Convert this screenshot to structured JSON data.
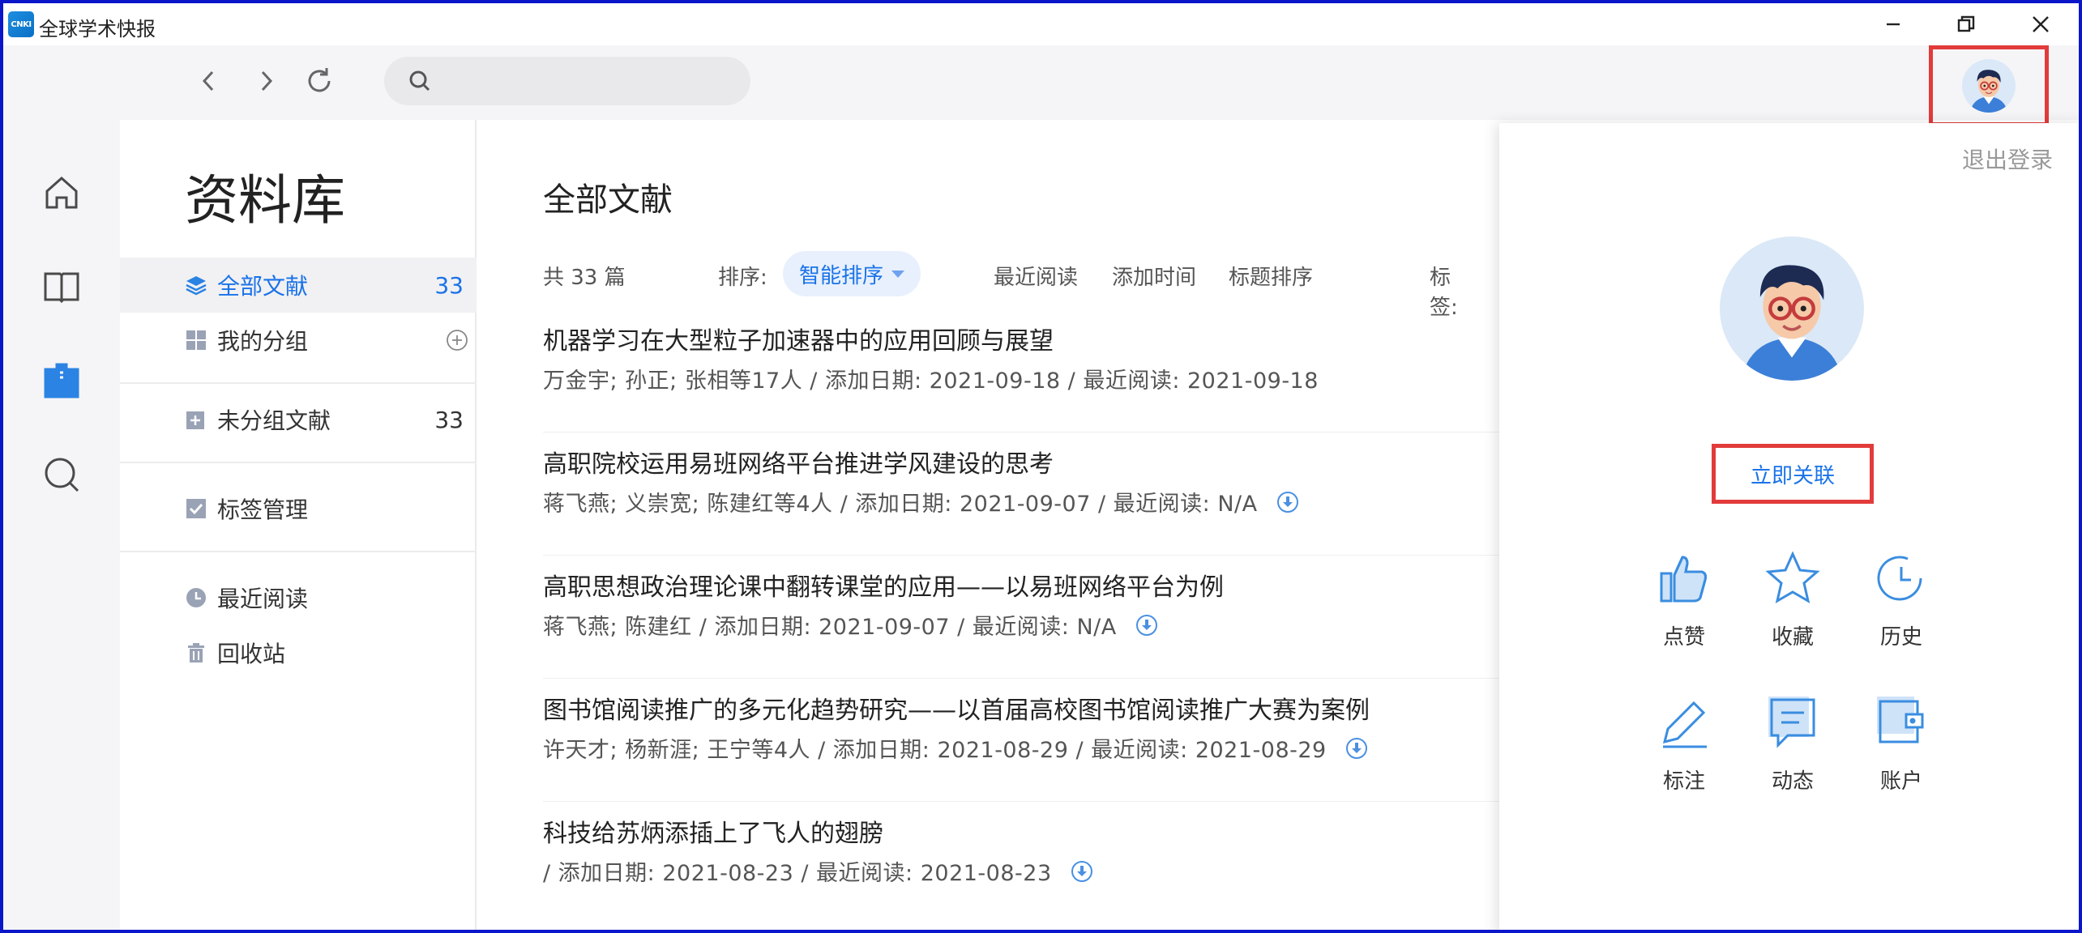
{
  "app": {
    "title": "全球学术快报",
    "logo_text": "CNKI"
  },
  "toolbar": {
    "search_placeholder": ""
  },
  "library": {
    "title": "资料库",
    "items": [
      {
        "label": "全部文献",
        "count": "33"
      },
      {
        "label": "我的分组",
        "count": ""
      },
      {
        "label": "未分组文献",
        "count": "33"
      },
      {
        "label": "标签管理",
        "count": ""
      },
      {
        "label": "最近阅读",
        "count": ""
      },
      {
        "label": "回收站",
        "count": ""
      }
    ]
  },
  "main": {
    "title": "全部文献",
    "total": "共 33 篇",
    "sort_label": "排序:",
    "sort_options": [
      "智能排序",
      "最近阅读",
      "添加时间",
      "标题排序"
    ],
    "tag_label": "标签:",
    "documents": [
      {
        "title": "机器学习在大型粒子加速器中的应用回顾与展望",
        "meta": "万金宇; 孙正; 张相等17人 / 添加日期: 2021-09-18 / 最近阅读: 2021-09-18",
        "download": false
      },
      {
        "title": "高职院校运用易班网络平台推进学风建设的思考",
        "meta": "蒋飞燕; 义崇宽; 陈建红等4人 / 添加日期: 2021-09-07 / 最近阅读: N/A",
        "download": true
      },
      {
        "title": "高职思想政治理论课中翻转课堂的应用——以易班网络平台为例",
        "meta": "蒋飞燕; 陈建红 / 添加日期: 2021-09-07 / 最近阅读: N/A",
        "download": true
      },
      {
        "title": "图书馆阅读推广的多元化趋势研究——以首届高校图书馆阅读推广大赛为案例",
        "meta": "许天才; 杨新涯; 王宁等4人 / 添加日期: 2021-08-29 / 最近阅读: 2021-08-29",
        "download": true
      },
      {
        "title": "科技给苏炳添插上了飞人的翅膀",
        "meta": "/ 添加日期: 2021-08-23 / 最近阅读: 2021-08-23",
        "download": true
      }
    ]
  },
  "popup": {
    "logout": "退出登录",
    "username": "",
    "link_action": "立即关联",
    "actions": [
      {
        "label": "点赞",
        "icon": "thumbs-up-icon"
      },
      {
        "label": "收藏",
        "icon": "star-icon"
      },
      {
        "label": "历史",
        "icon": "clock-icon"
      },
      {
        "label": "标注",
        "icon": "pencil-icon"
      },
      {
        "label": "动态",
        "icon": "message-icon"
      },
      {
        "label": "账户",
        "icon": "wallet-icon"
      }
    ]
  },
  "colors": {
    "accent": "#1a73e8",
    "highlight_box": "#e23b3b",
    "window_border": "#0b16c9",
    "icon_blue": "#3a8de0"
  }
}
